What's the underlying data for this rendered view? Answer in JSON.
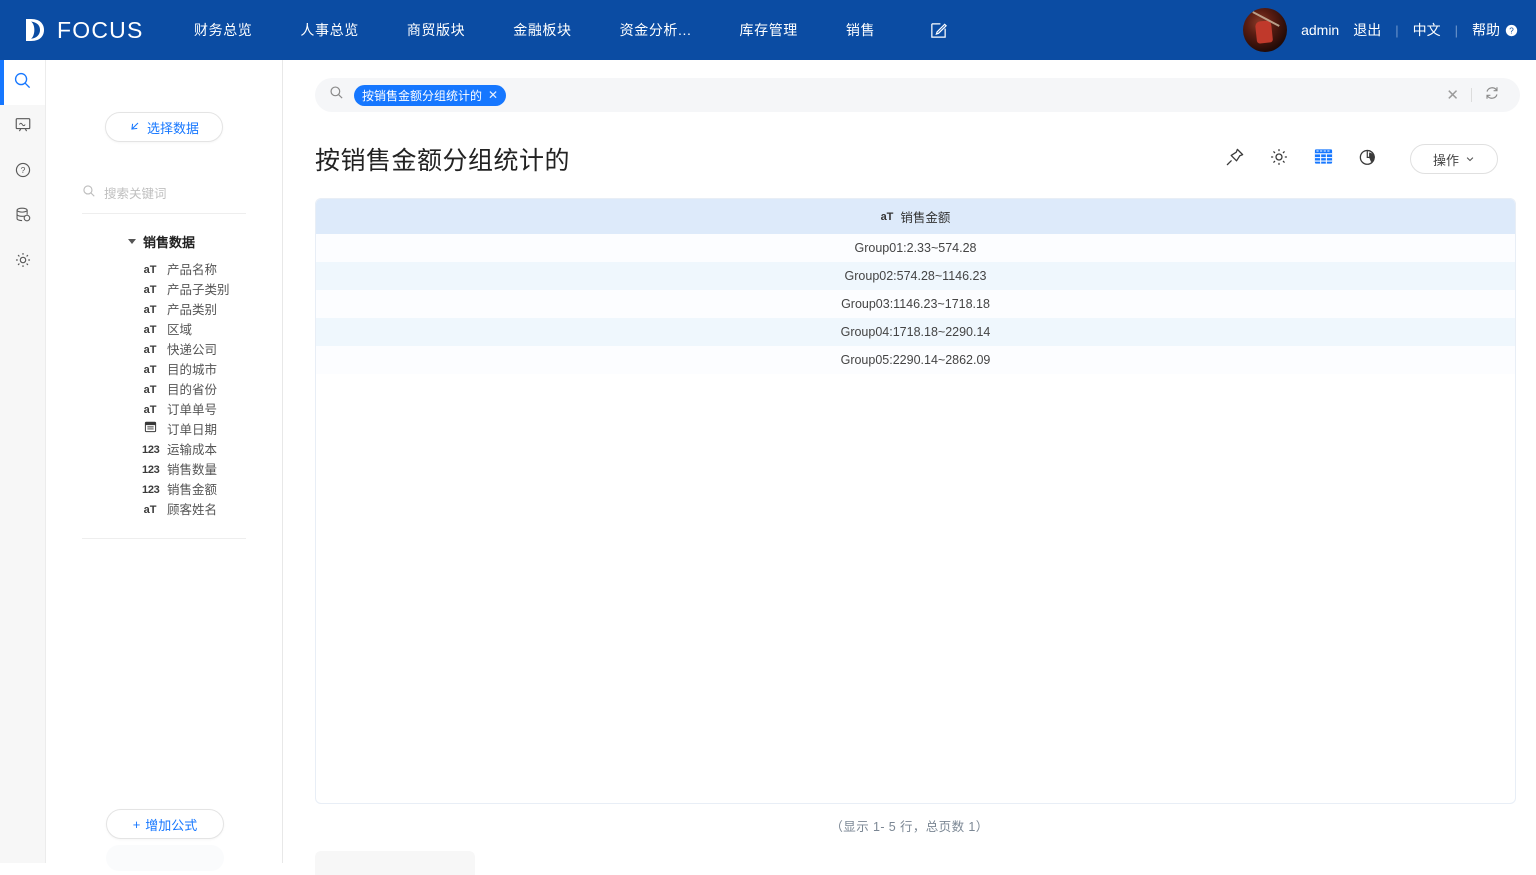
{
  "header": {
    "brand": "FOCUS",
    "brand_icon": "focus-logo-icon",
    "nav_items": [
      {
        "label": "财务总览"
      },
      {
        "label": "人事总览"
      },
      {
        "label": "商贸版块"
      },
      {
        "label": "金融板块"
      },
      {
        "label": "资金分析..."
      },
      {
        "label": "库存管理"
      },
      {
        "label": "销售"
      }
    ],
    "edit_icon": "edit-square-icon",
    "user": "admin",
    "logout": "退出",
    "language": "中文",
    "help": "帮助",
    "separator": "|",
    "avatar_icon": "user-avatar"
  },
  "rail": {
    "items": [
      {
        "icon": "search-icon",
        "active": true
      },
      {
        "icon": "dashboard-board-icon",
        "active": false
      },
      {
        "icon": "question-circle-icon",
        "active": false
      },
      {
        "icon": "database-icon",
        "active": false
      },
      {
        "icon": "gear-icon",
        "active": false
      }
    ]
  },
  "panel": {
    "select_data_label": "选择数据",
    "select_data_icon": "cursor-arrow-icon",
    "search_placeholder": "搜索关键词",
    "search_value": "",
    "search_icon": "search-icon",
    "tree_root": "销售数据",
    "fields": [
      {
        "name": "产品名称",
        "type": "aT"
      },
      {
        "name": "产品子类别",
        "type": "aT"
      },
      {
        "name": "产品类别",
        "type": "aT"
      },
      {
        "name": "区域",
        "type": "aT"
      },
      {
        "name": "快递公司",
        "type": "aT"
      },
      {
        "name": "目的城市",
        "type": "aT"
      },
      {
        "name": "目的省份",
        "type": "aT"
      },
      {
        "name": "订单单号",
        "type": "aT"
      },
      {
        "name": "订单日期",
        "type": "cal"
      },
      {
        "name": "运输成本",
        "type": "123"
      },
      {
        "name": "销售数量",
        "type": "123"
      },
      {
        "name": "销售金额",
        "type": "123"
      },
      {
        "name": "顾客姓名",
        "type": "aT"
      }
    ],
    "add_formula_label": "增加公式",
    "add_formula_icon": "plus-icon"
  },
  "main": {
    "search": {
      "icon": "search-icon",
      "chip_label": "按销售金额分组统计的",
      "chip_close_icon": "close-icon",
      "clear_icon": "close-icon",
      "refresh_icon": "refresh-icon",
      "input_value": ""
    },
    "title": "按销售金额分组统计的",
    "tools": [
      {
        "icon": "pin-icon",
        "name": "pin-button",
        "active": false
      },
      {
        "icon": "gear-icon",
        "name": "settings-button",
        "active": false
      },
      {
        "icon": "table-icon",
        "name": "table-view-button",
        "active": true
      },
      {
        "icon": "pie-icon",
        "name": "chart-view-button",
        "active": false
      }
    ],
    "operation_button": "操作",
    "operation_caret_icon": "chevron-down-icon",
    "pager_text": "（显示 1- 5 行，总页数 1）"
  },
  "chart_data": {
    "type": "table",
    "title": "按销售金额分组统计的",
    "columns": [
      {
        "label": "销售金额",
        "type_icon": "aT"
      }
    ],
    "rows": [
      [
        "Group01:2.33~574.28"
      ],
      [
        "Group02:574.28~1146.23"
      ],
      [
        "Group03:1146.23~1718.18"
      ],
      [
        "Group04:1718.18~2290.14"
      ],
      [
        "Group05:2290.14~2862.09"
      ]
    ],
    "row_count": 5,
    "page_count": 1
  },
  "colors": {
    "brand_blue": "#0b4ca3",
    "accent_blue": "#1677ff",
    "table_header": "#ddeafa",
    "row_even": "#eff7fd",
    "row_odd": "#fcfdff"
  }
}
